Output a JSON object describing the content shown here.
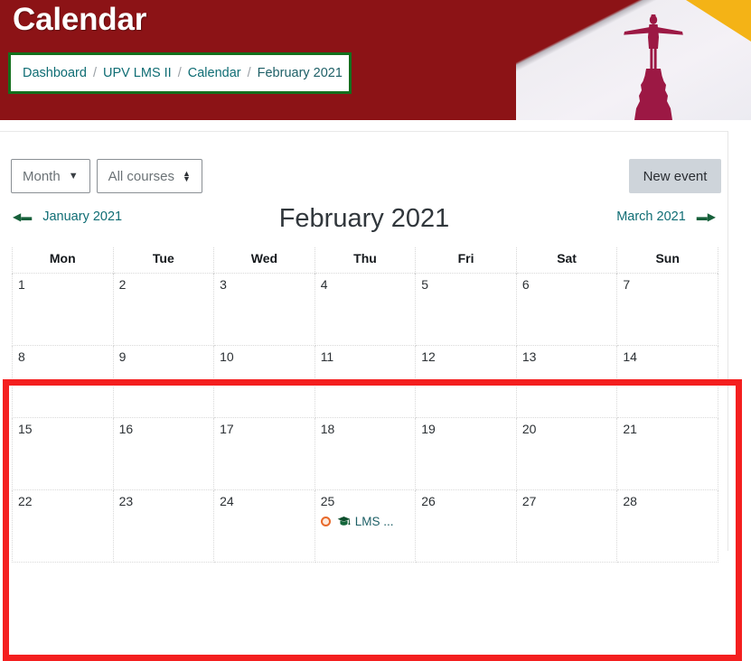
{
  "header": {
    "title": "Calendar",
    "logo_icon": "upv-statue-logo",
    "breadcrumb": {
      "separator": "/",
      "items": [
        {
          "label": "Dashboard",
          "current": false
        },
        {
          "label": "UPV LMS II",
          "current": false
        },
        {
          "label": "Calendar",
          "current": false
        },
        {
          "label": "February 2021",
          "current": true
        }
      ]
    },
    "colors": {
      "banner_bg": "#8c1316",
      "gold_corner": "#f4b316",
      "breadcrumb_border": "#13701d"
    }
  },
  "toolbar": {
    "view_select": {
      "label": "Month",
      "icon": "chevron-down-icon"
    },
    "course_select": {
      "label": "All courses",
      "icon": "up-down-arrow-icon"
    },
    "new_event_button": "New event"
  },
  "nav": {
    "prev_label": "January 2021",
    "prev_icon": "arrow-left-icon",
    "next_label": "March 2021",
    "next_icon": "arrow-right-icon",
    "month_title": "February 2021"
  },
  "calendar": {
    "weekday_headers": [
      "Mon",
      "Tue",
      "Wed",
      "Thu",
      "Fri",
      "Sat",
      "Sun"
    ],
    "weeks": [
      [
        {
          "day": "1"
        },
        {
          "day": "2"
        },
        {
          "day": "3"
        },
        {
          "day": "4"
        },
        {
          "day": "5"
        },
        {
          "day": "6"
        },
        {
          "day": "7"
        }
      ],
      [
        {
          "day": "8"
        },
        {
          "day": "9"
        },
        {
          "day": "10"
        },
        {
          "day": "11"
        },
        {
          "day": "12"
        },
        {
          "day": "13"
        },
        {
          "day": "14"
        }
      ],
      [
        {
          "day": "15"
        },
        {
          "day": "16"
        },
        {
          "day": "17"
        },
        {
          "day": "18"
        },
        {
          "day": "19"
        },
        {
          "day": "20"
        },
        {
          "day": "21"
        }
      ],
      [
        {
          "day": "22"
        },
        {
          "day": "23"
        },
        {
          "day": "24"
        },
        {
          "day": "25",
          "event": {
            "label": "LMS ...",
            "dot_color": "#e8692a",
            "type_icon": "graduation-cap-icon"
          }
        },
        {
          "day": "26"
        },
        {
          "day": "27"
        },
        {
          "day": "28"
        }
      ]
    ]
  },
  "annotation": {
    "red_highlight_color": "#f41f1f"
  }
}
